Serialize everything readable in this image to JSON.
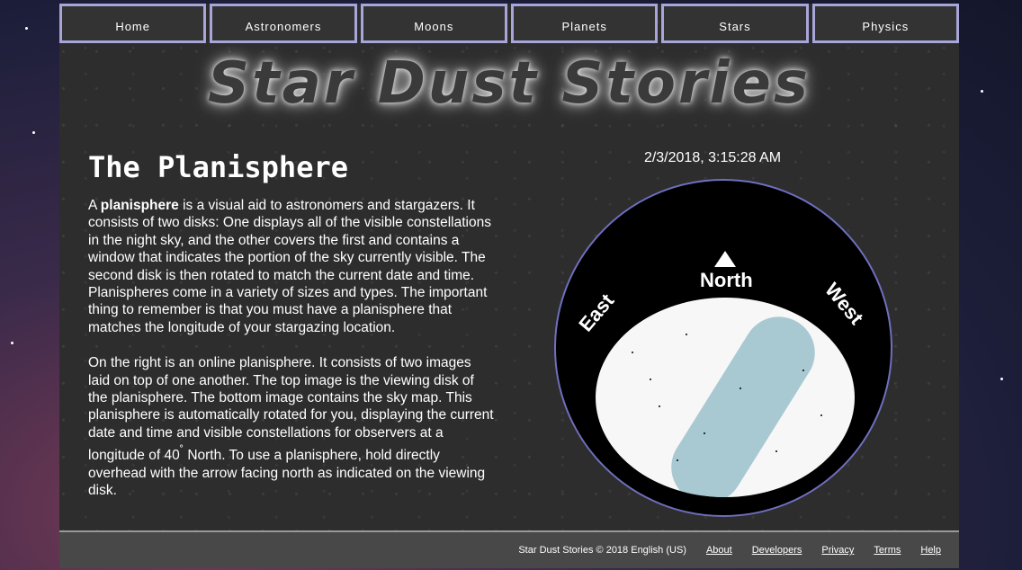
{
  "nav": {
    "items": [
      "Home",
      "Astronomers",
      "Moons",
      "Planets",
      "Stars",
      "Physics"
    ]
  },
  "logo": "Star Dust Stories",
  "article": {
    "title": "The Planisphere",
    "p1_prefix": "A ",
    "p1_bold": "planisphere",
    "p1_rest": " is a visual aid to astronomers and stargazers. It consists of two disks: One displays all of the visible constellations in the night sky, and the other covers the first and contains a window that indicates the portion of the sky currently visible. The second disk is then rotated to match the current date and time. Planispheres come in a variety of sizes and types. The important thing to remember is that you must have a planisphere that matches the longitude of your stargazing location.",
    "p2_part1": "On the right is an online planisphere. It consists of two images laid on top of one another. The top image is the viewing disk of the planisphere. The bottom image contains the sky map. This planisphere is automatically rotated for you, displaying the current date and time and visible constellations for observers at a longitude of 40",
    "p2_deg": "˚",
    "p2_part2": " North. To use a planisphere, hold directly overhead with the arrow facing north as indicated on the viewing disk."
  },
  "clock": "2/3/2018, 3:15:28 AM",
  "planisphere": {
    "north": "North",
    "east": "East",
    "west": "West"
  },
  "footer": {
    "copyright": "Star Dust Stories © 2018 English (US)",
    "links": [
      "About",
      "Developers",
      "Privacy",
      "Terms",
      "Help"
    ]
  },
  "colors": {
    "nav_border": "#a8a6d8",
    "page_bg": "#2d2d2d",
    "footer_bg": "#484848",
    "milky_way": "#9fc3cc"
  }
}
